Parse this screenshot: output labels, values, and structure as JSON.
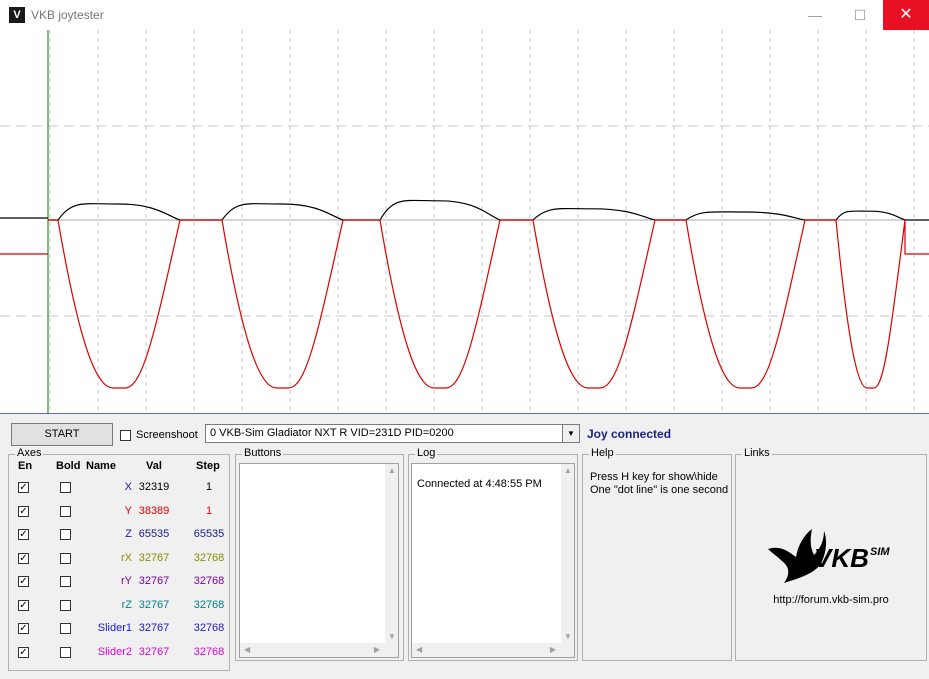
{
  "window": {
    "title": "VKB joytester",
    "app_icon": "vkb-bird-icon",
    "minimize": "—",
    "maximize": "☐",
    "close": "✕"
  },
  "plot": {
    "colors": {
      "series_black": "#000000",
      "series_red": "#dd0000",
      "vertical_cursor": "#007700",
      "grid": "#c8c8c8"
    }
  },
  "toolbar": {
    "start_label": "START",
    "screenshot_label": "Screenshoot",
    "screenshot_checked": false,
    "device_select": "0  VKB-Sim Gladiator NXT R   VID=231D PID=0200",
    "status": "Joy connected"
  },
  "axes": {
    "title": "Axes",
    "headers": {
      "en": "En",
      "bold": "Bold",
      "name": "Name",
      "val": "Val",
      "step": "Step"
    },
    "rows": [
      {
        "name": "X",
        "val": "32319",
        "step": "1",
        "color": "#1a1a8c",
        "val_color": "#000000",
        "en": "✓",
        "bold": ""
      },
      {
        "name": "Y",
        "val": "38389",
        "step": "1",
        "color": "#dd0000",
        "val_color": "#dd0000",
        "en": "✓",
        "bold": ""
      },
      {
        "name": "Z",
        "val": "65535",
        "step": "65535",
        "color": "#1a1a8c",
        "val_color": "#1a1a8c",
        "en": "✓",
        "bold": ""
      },
      {
        "name": "rX",
        "val": "32767",
        "step": "32768",
        "color": "#8b8b00",
        "val_color": "#8b8b00",
        "en": "✓",
        "bold": ""
      },
      {
        "name": "rY",
        "val": "32767",
        "step": "32768",
        "color": "#7a00a8",
        "val_color": "#7a00a8",
        "en": "✓",
        "bold": ""
      },
      {
        "name": "rZ",
        "val": "32767",
        "step": "32768",
        "color": "#00808a",
        "val_color": "#00808a",
        "en": "✓",
        "bold": ""
      },
      {
        "name": "Slider1",
        "val": "32767",
        "step": "32768",
        "color": "#1a1acc",
        "val_color": "#1a1acc",
        "en": "✓",
        "bold": ""
      },
      {
        "name": "Slider2",
        "val": "32767",
        "step": "32768",
        "color": "#dd00dd",
        "val_color": "#dd00dd",
        "en": "✓",
        "bold": ""
      }
    ]
  },
  "buttons_group": {
    "title": "Buttons"
  },
  "log_group": {
    "title": "Log",
    "entries": [
      "Connected at 4:48:55 PM"
    ]
  },
  "help_group": {
    "title": "Help",
    "line1": "Press H key for show\\hide",
    "line2": "One \"dot line\" is one second"
  },
  "links_group": {
    "title": "Links",
    "logo_text": "VKB",
    "logo_sup": "SIM",
    "url": "http://forum.vkb-sim.pro"
  }
}
